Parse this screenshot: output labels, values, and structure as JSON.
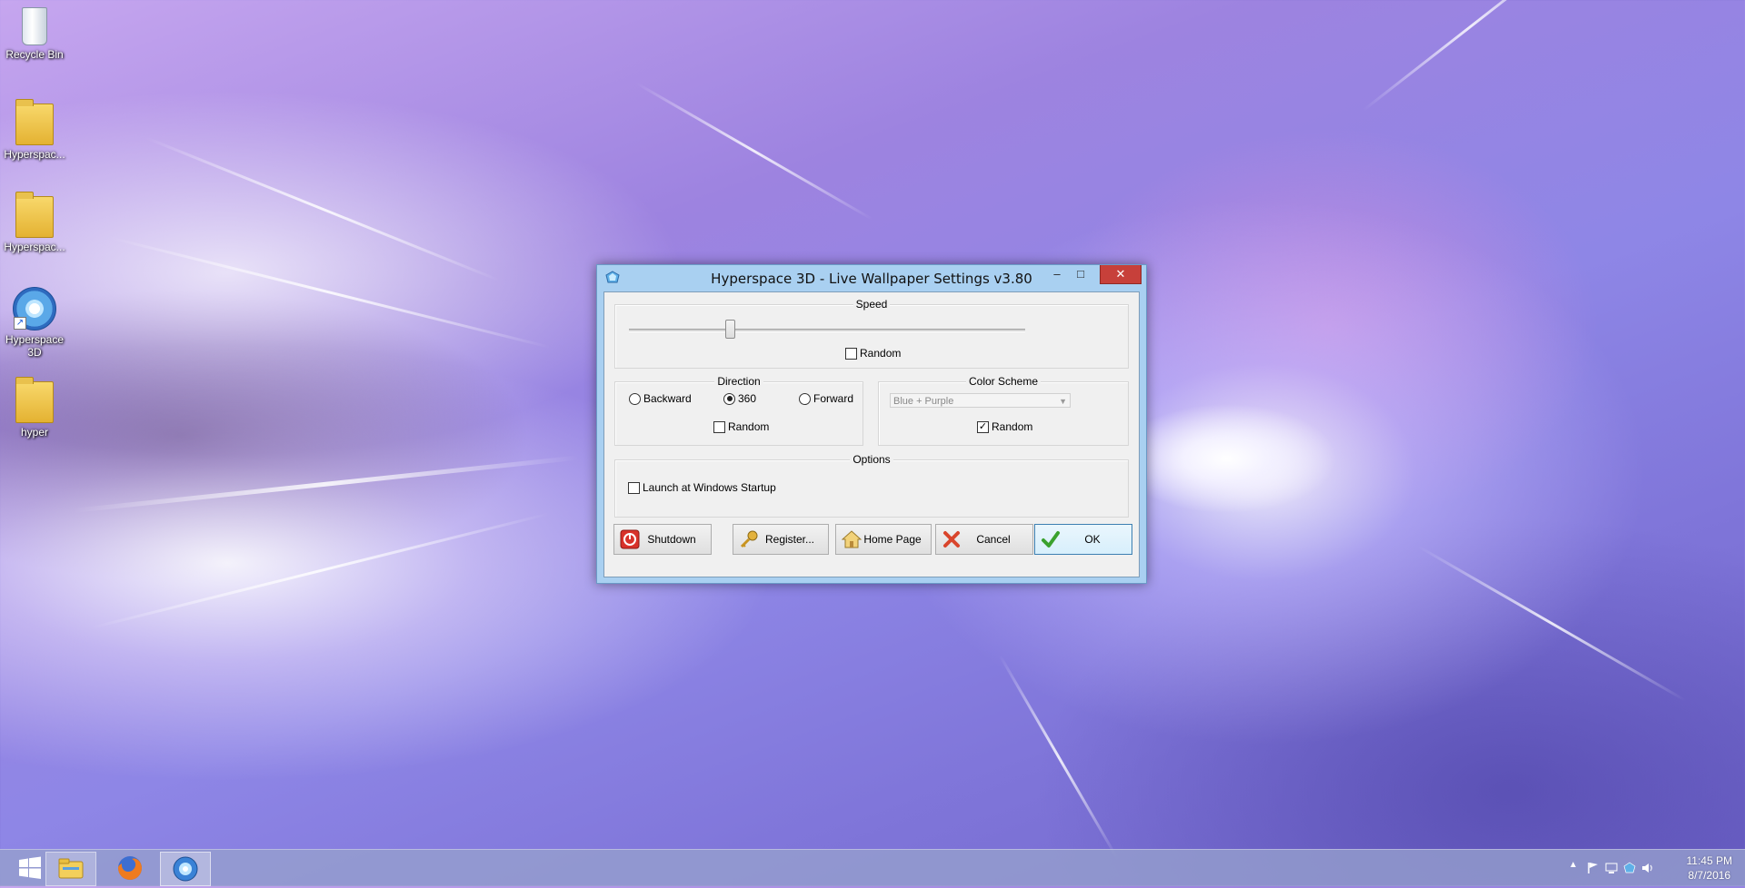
{
  "desktop": {
    "icons": [
      {
        "label": "Recycle Bin",
        "icon": "recycle-bin-icon"
      },
      {
        "label": "Hyperspac...",
        "icon": "folder-zip-icon"
      },
      {
        "label": "Hyperspac...",
        "icon": "installer-icon"
      },
      {
        "label": "Hyperspace 3D",
        "icon": "hyperspace-app-icon"
      },
      {
        "label": "hyper",
        "icon": "folder-icon"
      }
    ]
  },
  "window": {
    "title": "Hyperspace 3D - Live Wallpaper Settings  v3.80",
    "controls": {
      "minimize": "–",
      "maximize": "□",
      "close": "✕"
    }
  },
  "speed": {
    "label": "Speed",
    "slider_value_fraction": 0.25,
    "random_label": "Random",
    "random_checked": false
  },
  "direction": {
    "label": "Direction",
    "options": [
      "Backward",
      "360",
      "Forward"
    ],
    "selected": "360",
    "random_label": "Random",
    "random_checked": false
  },
  "color_scheme": {
    "label": "Color Scheme",
    "selected": "Blue + Purple",
    "disabled": true,
    "random_label": "Random",
    "random_checked": true
  },
  "options": {
    "label": "Options",
    "launch_label": "Launch at Windows Startup",
    "launch_checked": false
  },
  "buttons": {
    "shutdown": "Shutdown",
    "register": "Register...",
    "home_page": "Home Page",
    "cancel": "Cancel",
    "ok": "OK"
  },
  "taskbar": {
    "items": [
      "start-icon",
      "file-explorer-icon",
      "firefox-icon",
      "hyperspace-app-icon"
    ],
    "clock_time": "11:45 PM",
    "clock_date": "8/7/2016"
  },
  "colors": {
    "close_button": "#c7403a",
    "title_bar": "#a9d0f1",
    "ok_border": "#3c7fb1"
  }
}
